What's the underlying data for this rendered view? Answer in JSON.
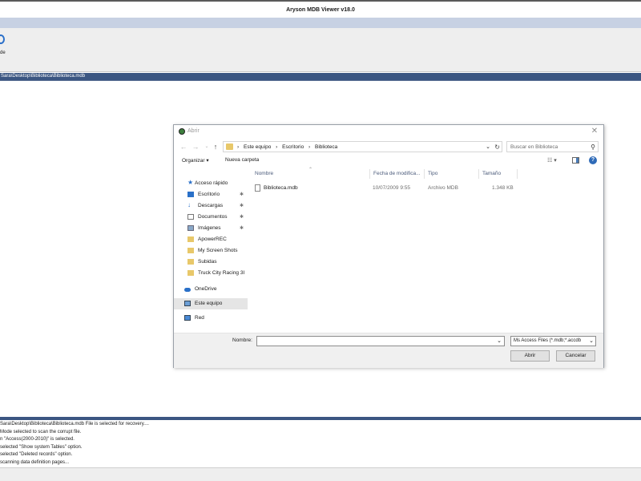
{
  "app": {
    "title": "Aryson MDB Viewer v18.0",
    "toolbar_button_label": "de",
    "path": "Sara\\Desktop\\Biblioteca\\Biblioteca.mdb",
    "accent": "#3b5682"
  },
  "log": [
    "Sara\\Desktop\\Biblioteca\\Biblioteca.mdb File is selected for recovery....",
    "Mode selected to scan the corrupt file.",
    "n \"Access(2000-2010)\" is selected.",
    "selected \"Show system Tables\" option.",
    "selected \"Deleted records\" option.",
    "scanning data definition pages..."
  ],
  "dialog": {
    "title": "Abrir",
    "close_glyph": "✕",
    "breadcrumbs": [
      "Este equipo",
      "Escritorio",
      "Biblioteca"
    ],
    "crumb_sep": "›",
    "search_placeholder": "Buscar en Biblioteca",
    "organize_label": "Organizar ▾",
    "new_folder_label": "Nueva carpeta",
    "help_glyph": "?",
    "nav_items": [
      {
        "label": "Acceso rápido",
        "icon": "star-icon"
      },
      {
        "label": "Escritorio",
        "icon": "desktop-icon",
        "pinned": true
      },
      {
        "label": "Descargas",
        "icon": "download-icon",
        "pinned": true
      },
      {
        "label": "Documentos",
        "icon": "documents-icon",
        "pinned": true
      },
      {
        "label": "Imágenes",
        "icon": "pictures-icon",
        "pinned": true
      },
      {
        "label": "ApowerREC",
        "icon": "folder-icon"
      },
      {
        "label": "My Screen Shots",
        "icon": "folder-icon"
      },
      {
        "label": "Subidas",
        "icon": "folder-icon"
      },
      {
        "label": "Truck City Racing 3I",
        "icon": "folder-icon"
      },
      {
        "label": "OneDrive",
        "icon": "cloud-icon"
      },
      {
        "label": "Este equipo",
        "icon": "computer-icon",
        "selected": true
      },
      {
        "label": "Red",
        "icon": "network-icon"
      }
    ],
    "columns": [
      "Nombre",
      "Fecha de modifica...",
      "Tipo",
      "Tamaño"
    ],
    "files": [
      {
        "name": "Biblioteca.mdb",
        "date": "10/07/2009 9:55",
        "type": "Archivo MDB",
        "size": "1.348 KB"
      }
    ],
    "filename_label": "Nombre:",
    "filename_value": "",
    "filter_value": "Ms Access Files (*.mdb;*.accdb",
    "open_label": "Abrir",
    "cancel_label": "Cancelar"
  }
}
